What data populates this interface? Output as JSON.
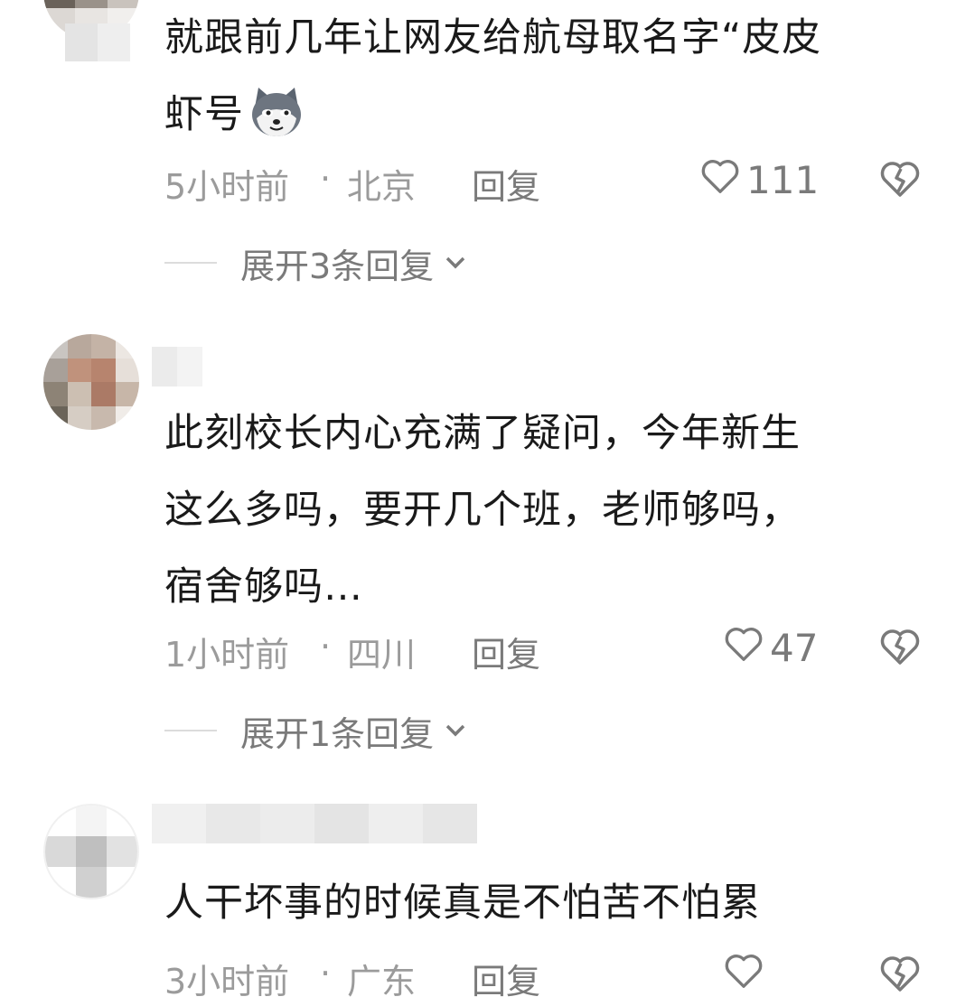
{
  "comments": [
    {
      "text_line1": "就跟前几年让网友给航母取名字“皮皮",
      "text_line2": "虾号",
      "emoji_icon": "husky-dog-emoji",
      "time": "5小时前",
      "separator": "·",
      "location": "北京",
      "reply_label": "回复",
      "likes": "111",
      "expand_label": "展开3条回复"
    },
    {
      "text_line1": "此刻校长内心充满了疑问，今年新生",
      "text_line2": "这么多吗，要开几个班，老师够吗，",
      "text_line3": "宿舍够吗…",
      "time": "1小时前",
      "separator": "·",
      "location": "四川",
      "reply_label": "回复",
      "likes": "47",
      "expand_label": "展开1条回复"
    },
    {
      "text_line1": "人干坏事的时候真是不怕苦不怕累",
      "time": "3小时前",
      "separator": "·",
      "location": "广东",
      "reply_label": "回复"
    }
  ],
  "icons": {
    "like": "heart-outline-icon",
    "dislike": "broken-heart-icon",
    "expand": "chevron-down-icon"
  },
  "colors": {
    "text": "#1a1a1a",
    "meta": "#9b9b9b",
    "action": "#7a7a7a"
  }
}
